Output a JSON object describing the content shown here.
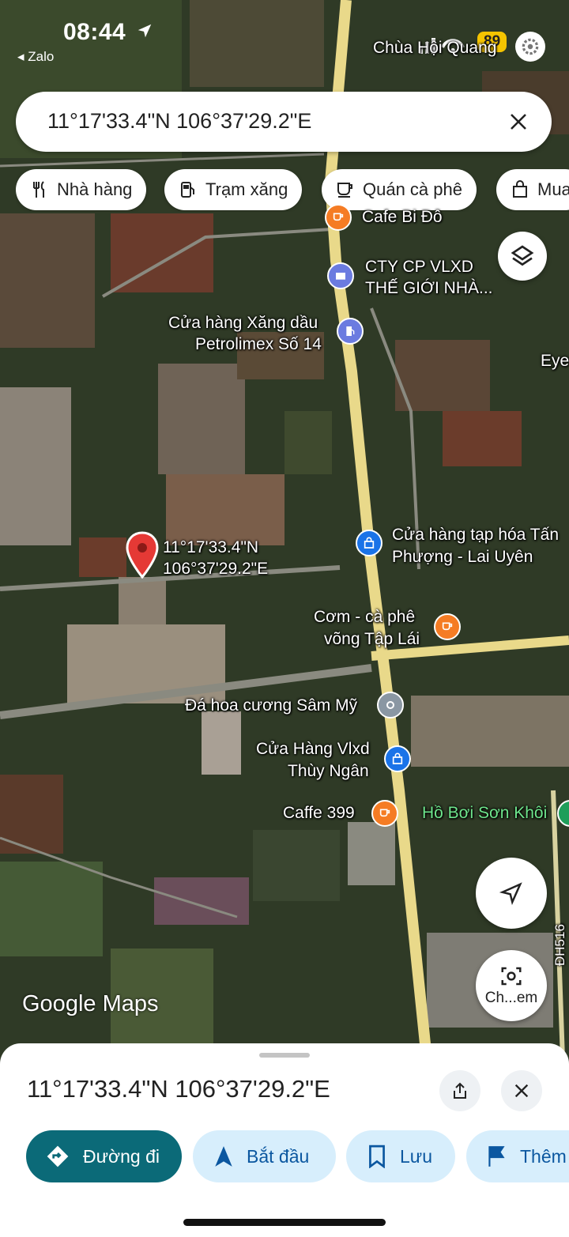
{
  "status_bar": {
    "time": "08:44",
    "back_app": "◂ Zalo",
    "battery": "89"
  },
  "search": {
    "query": "11°17'33.4\"N 106°37'29.2\"E"
  },
  "chips": [
    {
      "label": "Nhà hàng",
      "icon": "fork-knife-icon"
    },
    {
      "label": "Trạm xăng",
      "icon": "gas-pump-icon"
    },
    {
      "label": "Quán cà phê",
      "icon": "coffee-cup-icon"
    },
    {
      "label": "Mua",
      "icon": "shopping-bag-icon"
    }
  ],
  "map": {
    "top_label": "Chùa Hội Quang",
    "edge_label": "Eye",
    "road_label": "ĐH516",
    "pin_label": [
      "11°17'33.4\"N",
      "106°37'29.2\"E"
    ],
    "pois": [
      {
        "id": "cafe-bi-do",
        "lines": [
          "Cafe Bi Đô"
        ],
        "icon": "coffee-icon",
        "color": "#f57c24"
      },
      {
        "id": "cty-vlxd",
        "lines": [
          "CTY CP VLXD",
          "THẾ GIỚI NHÀ..."
        ],
        "icon": "building-icon",
        "color": "#6b7be0"
      },
      {
        "id": "petrolimex",
        "lines": [
          "Cửa hàng Xăng dầu",
          "Petrolimex Số 14"
        ],
        "icon": "gas-pump-icon",
        "color": "#6b7be0"
      },
      {
        "id": "tap-hoa",
        "lines": [
          "Cửa hàng tạp hóa Tấn",
          "Phượng - Lai Uyên"
        ],
        "icon": "shopping-bag-icon",
        "color": "#1a73e8"
      },
      {
        "id": "com-ca-phe",
        "lines": [
          "Cơm - cà phê",
          "võng Tập Lái"
        ],
        "icon": "coffee-icon",
        "color": "#f57c24"
      },
      {
        "id": "da-hoa-cuong",
        "lines": [
          "Đá hoa cương Sâm Mỹ"
        ],
        "icon": "place-icon",
        "color": "#8a97a3"
      },
      {
        "id": "vlxd-thuy-ngan",
        "lines": [
          "Cửa Hàng Vlxd",
          "Thùy Ngân"
        ],
        "icon": "shopping-bag-icon",
        "color": "#1a73e8"
      },
      {
        "id": "caffe-399",
        "lines": [
          "Caffe 399"
        ],
        "icon": "coffee-icon",
        "color": "#f57c24"
      },
      {
        "id": "ho-boi",
        "lines": [
          "Hồ Bơi Sơn Khôi"
        ],
        "icon": "pool-icon",
        "color": "#1e9e5a"
      }
    ],
    "wordmark": "Google Maps",
    "streetview_label": "Ch...em"
  },
  "sheet": {
    "title": "11°17'33.4\"N 106°37'29.2\"E",
    "actions": [
      {
        "label": "Đường đi",
        "icon": "directions-icon"
      },
      {
        "label": "Bắt đầu",
        "icon": "navigation-arrow-icon"
      },
      {
        "label": "Lưu",
        "icon": "bookmark-icon"
      },
      {
        "label": "Thêm",
        "icon": "flag-icon"
      }
    ]
  }
}
